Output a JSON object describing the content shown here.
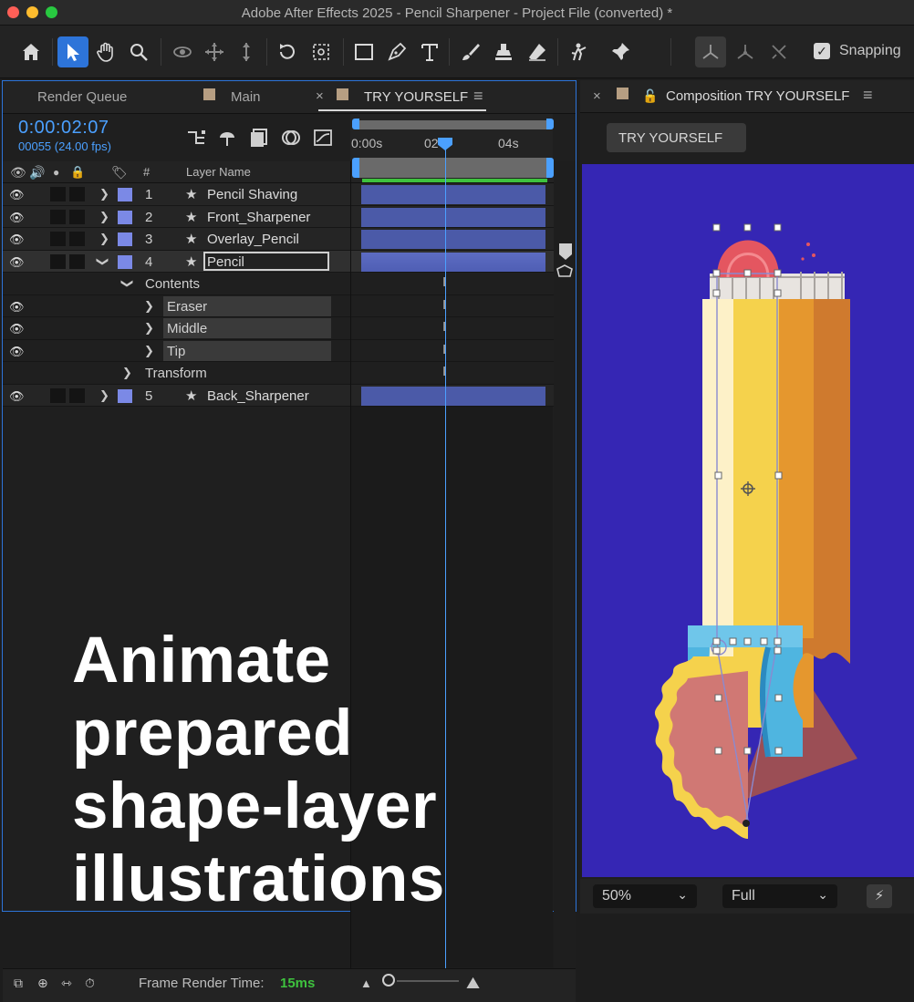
{
  "window": {
    "title": "Adobe After Effects 2025 - Pencil Sharpener - Project File (converted) *"
  },
  "toolbar": {
    "tools": [
      "home-icon",
      "selection-tool-icon",
      "hand-tool-icon",
      "zoom-tool-icon",
      "orbit-camera-icon",
      "pan-camera-icon",
      "dolly-camera-icon",
      "rotate-tool-icon",
      "pan-behind-tool-icon",
      "rectangle-tool-icon",
      "pen-tool-icon",
      "type-tool-icon",
      "brush-tool-icon",
      "clone-stamp-icon",
      "eraser-tool-icon",
      "puppet-tool-icon",
      "pin-icon"
    ],
    "snapping_label": "Snapping",
    "snapping_checked": true
  },
  "timeline": {
    "tabs": [
      {
        "label": "Render Queue"
      },
      {
        "label": "Main"
      },
      {
        "label": "TRY YOURSELF",
        "active": true
      }
    ],
    "timecode": "0:00:02:07",
    "frame_info": "00055 (24.00 fps)",
    "ruler_ticks": [
      "0:00s",
      "02",
      "04s"
    ],
    "column_headers": {
      "number": "#",
      "layer_name": "Layer Name"
    },
    "layers": [
      {
        "num": "1",
        "name": "Pencil Shaving"
      },
      {
        "num": "2",
        "name": "Front_Sharpener"
      },
      {
        "num": "3",
        "name": "Overlay_Pencil"
      },
      {
        "num": "4",
        "name": "Pencil",
        "selected": true
      },
      {
        "group": "Contents"
      },
      {
        "sub": "Eraser"
      },
      {
        "sub": "Middle"
      },
      {
        "sub": "Tip"
      },
      {
        "group": "Transform"
      },
      {
        "num": "5",
        "name": "Back_Sharpener"
      }
    ],
    "footer": {
      "render_time_label": "Frame Render Time:",
      "render_time_value": "15ms"
    }
  },
  "promo": {
    "line1": "Animate",
    "line2": "prepared",
    "line3": "shape-layer",
    "line4": "illustrations"
  },
  "composition": {
    "tab_label": "Composition TRY YOURSELF",
    "comp_button": "TRY YOURSELF",
    "zoom": "50%",
    "resolution": "Full",
    "background_color": "#3526b4"
  },
  "colors": {
    "accent": "#2d74d9",
    "timecode": "#4ba0ff",
    "layer_label": "#7b89e6",
    "render_time": "#3ec23e"
  }
}
